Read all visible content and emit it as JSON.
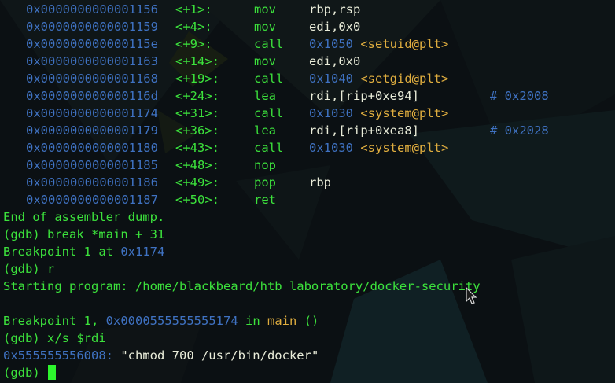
{
  "disasm": [
    {
      "addr": "0x0000000000001156",
      "off": "<+1>:",
      "mnem": "mov",
      "reg": "rbp,rsp",
      "num": "",
      "sym": "",
      "comment": ""
    },
    {
      "addr": "0x0000000000001159",
      "off": "<+4>:",
      "mnem": "mov",
      "reg": "edi,0x0",
      "num": "",
      "sym": "",
      "comment": ""
    },
    {
      "addr": "0x000000000000115e",
      "off": "<+9>:",
      "mnem": "call",
      "reg": "",
      "num": "0x1050",
      "sym": "<setuid@plt>",
      "comment": ""
    },
    {
      "addr": "0x0000000000001163",
      "off": "<+14>:",
      "mnem": "mov",
      "reg": "edi,0x0",
      "num": "",
      "sym": "",
      "comment": ""
    },
    {
      "addr": "0x0000000000001168",
      "off": "<+19>:",
      "mnem": "call",
      "reg": "",
      "num": "0x1040",
      "sym": "<setgid@plt>",
      "comment": ""
    },
    {
      "addr": "0x000000000000116d",
      "off": "<+24>:",
      "mnem": "lea",
      "reg": "rdi,[rip+0xe94]",
      "num": "",
      "sym": "",
      "comment": "# 0x2008"
    },
    {
      "addr": "0x0000000000001174",
      "off": "<+31>:",
      "mnem": "call",
      "reg": "",
      "num": "0x1030",
      "sym": "<system@plt>",
      "comment": ""
    },
    {
      "addr": "0x0000000000001179",
      "off": "<+36>:",
      "mnem": "lea",
      "reg": "rdi,[rip+0xea8]",
      "num": "",
      "sym": "",
      "comment": "# 0x2028"
    },
    {
      "addr": "0x0000000000001180",
      "off": "<+43>:",
      "mnem": "call",
      "reg": "",
      "num": "0x1030",
      "sym": "<system@plt>",
      "comment": ""
    },
    {
      "addr": "0x0000000000001185",
      "off": "<+48>:",
      "mnem": "nop",
      "reg": "",
      "num": "",
      "sym": "",
      "comment": ""
    },
    {
      "addr": "0x0000000000001186",
      "off": "<+49>:",
      "mnem": "pop",
      "reg": "rbp",
      "num": "",
      "sym": "",
      "comment": ""
    },
    {
      "addr": "0x0000000000001187",
      "off": "<+50>:",
      "mnem": "ret",
      "reg": "",
      "num": "",
      "sym": "",
      "comment": ""
    }
  ],
  "session": {
    "end_dump": "End of assembler dump.",
    "prompt": "(gdb)",
    "cmd_break": "break *main + 31",
    "bp_set_prefix": "Breakpoint 1 at",
    "bp_set_addr": "0x1174",
    "cmd_run": "r",
    "starting_program": "Starting program: /home/blackbeard/htb_laboratory/docker-security",
    "bp_hit_prefix": "Breakpoint 1,",
    "bp_hit_addr": "0x0000555555555174",
    "bp_hit_in": "in",
    "bp_hit_func": "main",
    "bp_hit_args": "()",
    "cmd_examine": "x/s $rdi",
    "str_addr": "0x555555556008:",
    "str_value": "\"chmod 700 /usr/bin/docker\""
  },
  "colors": {
    "background": "#0c1114",
    "prompt_green": "#3ce23c",
    "address_blue": "#3f72c2",
    "symbol_yellow": "#dfad3f",
    "text_white": "#e9ecd9",
    "cursor_green": "#2df52d"
  },
  "icons": {
    "mouse_pointer": "arrow-cursor-icon"
  }
}
